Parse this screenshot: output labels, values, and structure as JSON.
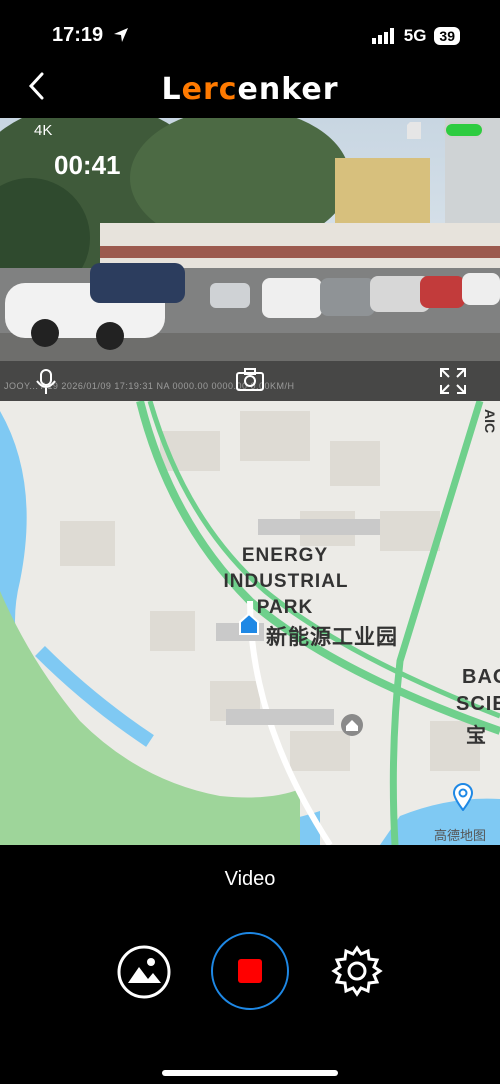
{
  "status": {
    "time": "17:19",
    "network": "5G",
    "battery": "39"
  },
  "header": {
    "brand_part1": "L",
    "brand_part2": "erc",
    "brand_part3": "enker"
  },
  "video": {
    "resolution": "4K",
    "timer": "00:41",
    "stamp": "JOOY... A19  2026/01/09  17:19:31  NA  0000.00  0000.00  0.00KM/H"
  },
  "map": {
    "labels": [
      "ENERGY",
      "INDUSTRIAL",
      "PARK",
      "新能源工业园"
    ],
    "edge_label_1": "BAO",
    "edge_label_2": "SCIE",
    "edge_label_3": "宝",
    "road_label": "AIC",
    "credit": "高德地图"
  },
  "bottom": {
    "mode_label": "Video"
  },
  "colors": {
    "accent": "#ff7a00",
    "record": "#ff0000",
    "ring": "#1e88e5",
    "road": "#6fd08c"
  }
}
